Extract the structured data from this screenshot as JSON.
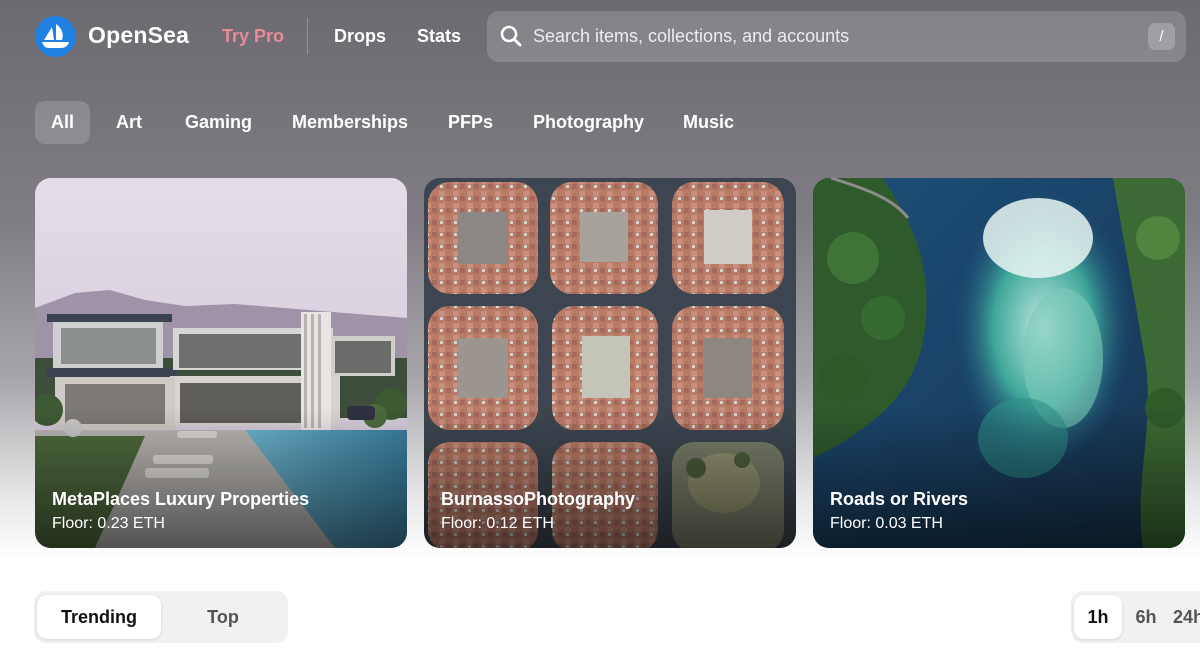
{
  "header": {
    "brand": "OpenSea",
    "try_pro": "Try Pro",
    "nav": {
      "drops": "Drops",
      "stats": "Stats"
    },
    "search": {
      "placeholder": "Search items, collections, and accounts",
      "shortcut": "/"
    }
  },
  "categories": [
    "All",
    "Art",
    "Gaming",
    "Memberships",
    "PFPs",
    "Photography",
    "Music"
  ],
  "active_category": "All",
  "featured": [
    {
      "title": "MetaPlaces Luxury Properties",
      "floor": "Floor: 0.23 ETH"
    },
    {
      "title": "BurnassoPhotography",
      "floor": "Floor: 0.12 ETH"
    },
    {
      "title": "Roads or Rivers",
      "floor": "Floor: 0.03 ETH"
    }
  ],
  "ranking_toggle": {
    "trending": "Trending",
    "top": "Top",
    "active": "Trending"
  },
  "time_range": {
    "options": [
      "1h",
      "6h",
      "24h"
    ],
    "active": "1h"
  },
  "colors": {
    "brand_blue": "#2081e2",
    "try_pro": "#e9899a"
  }
}
